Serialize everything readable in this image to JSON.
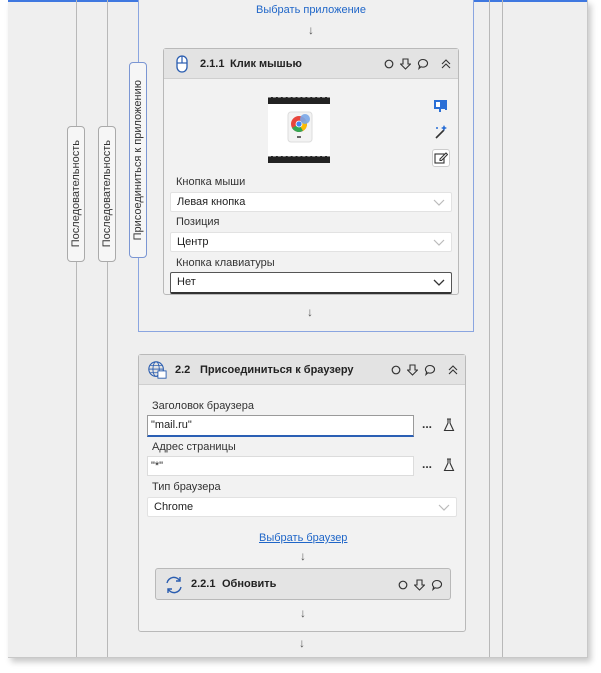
{
  "links": {
    "select_app": "Выбрать приложение",
    "select_browser": "Выбрать браузер"
  },
  "vertical_labels": {
    "sequence_1": "Последовательность",
    "sequence_2": "Последовательность",
    "attach_app": "Присоединиться к приложению"
  },
  "click_card": {
    "number": "2.1.1",
    "title": "Клик мышью",
    "fields": {
      "mouse_button_label": "Кнопка мыши",
      "mouse_button_value": "Левая кнопка",
      "position_label": "Позиция",
      "position_value": "Центр",
      "keyboard_label": "Кнопка клавиатуры",
      "keyboard_value": "Нет"
    }
  },
  "browser_card": {
    "number": "2.2",
    "title": "Присоединиться к браузеру",
    "fields": {
      "browser_title_label": "Заголовок браузера",
      "browser_title_value": "\"mail.ru\"",
      "page_url_label": "Адрес страницы",
      "page_url_value": "\"*\"",
      "browser_type_label": "Тип браузера",
      "browser_type_value": "Chrome"
    },
    "more_label": "...",
    "more_label_2": "..."
  },
  "refresh_card": {
    "number": "2.2.1",
    "title": "Обновить"
  },
  "icons": {
    "header_circle": "circle-icon",
    "header_down": "arrow-down-icon",
    "header_comment": "comment-icon",
    "header_collapse": "chevron-up-icon"
  },
  "colors": {
    "accent": "#1f66c8",
    "border_blue": "#8aa5e0",
    "card_header": "#e3e3e3",
    "top_line": "#3f78e0"
  }
}
